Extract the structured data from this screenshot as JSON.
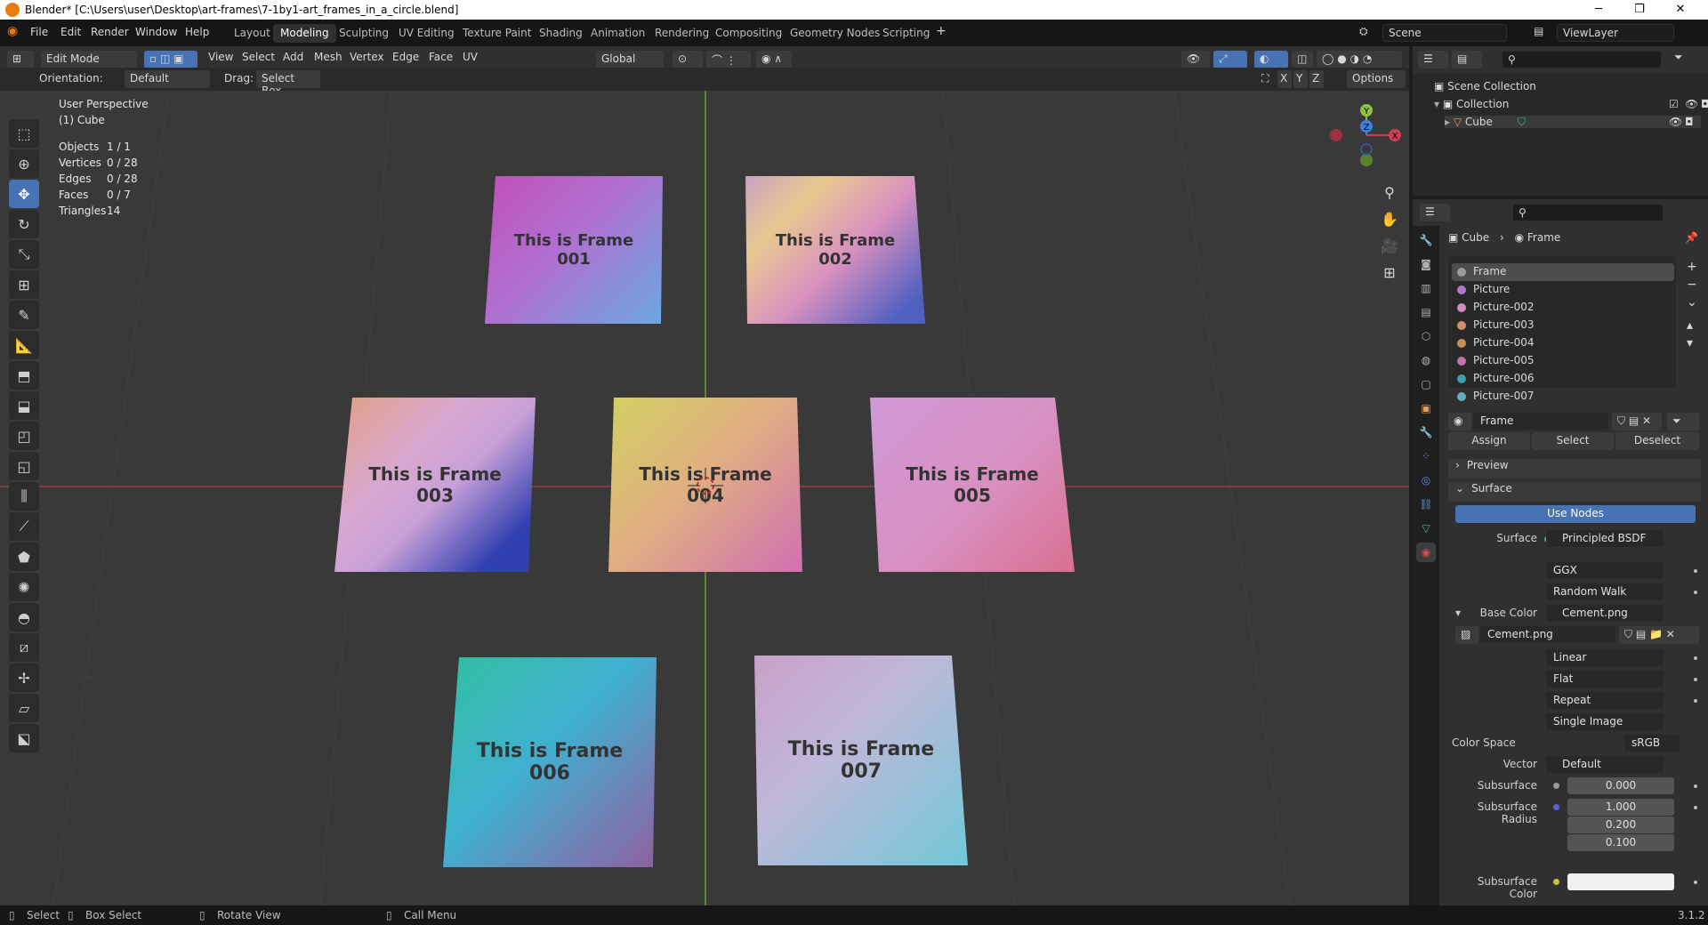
{
  "window": {
    "title": "Blender* [C:\\Users\\user\\Desktop\\art-frames\\7-1by1-art_frames_in_a_circle.blend]"
  },
  "menu": {
    "file": "File",
    "edit": "Edit",
    "render": "Render",
    "window": "Window",
    "help": "Help"
  },
  "workspaces": [
    "Layout",
    "Modeling",
    "Sculpting",
    "UV Editing",
    "Texture Paint",
    "Shading",
    "Animation",
    "Rendering",
    "Compositing",
    "Geometry Nodes",
    "Scripting"
  ],
  "active_workspace": "Modeling",
  "scene": "Scene",
  "view_layer": "ViewLayer",
  "header": {
    "mode": "Edit Mode",
    "view": "View",
    "select": "Select",
    "add": "Add",
    "mesh": "Mesh",
    "vertex": "Vertex",
    "edge": "Edge",
    "face": "Face",
    "uv": "UV",
    "transform": "Global",
    "orientation_label": "Orientation:",
    "orientation": "Default",
    "drag_label": "Drag:",
    "drag": "Select Box",
    "axis_x": "X",
    "axis_y": "Y",
    "axis_z": "Z",
    "options": "Options"
  },
  "viewport": {
    "perspective": "User Perspective",
    "object": "(1) Cube",
    "stats": [
      {
        "label": "Objects",
        "value": "1 / 1"
      },
      {
        "label": "Vertices",
        "value": "0 / 28"
      },
      {
        "label": "Edges",
        "value": "0 / 28"
      },
      {
        "label": "Faces",
        "value": "0 / 7"
      },
      {
        "label": "Triangles",
        "value": "14"
      }
    ],
    "frames": [
      {
        "line1": "This is Frame",
        "line2": "001"
      },
      {
        "line1": "This is Frame",
        "line2": "002"
      },
      {
        "line1": "This is Frame",
        "line2": "003"
      },
      {
        "line1": "This is Frame",
        "line2": "004"
      },
      {
        "line1": "This is Frame",
        "line2": "005"
      },
      {
        "line1": "This is Frame",
        "line2": "006"
      },
      {
        "line1": "This is Frame",
        "line2": "007"
      }
    ],
    "gizmo": {
      "x": "X",
      "y": "Y",
      "z": "Z"
    }
  },
  "outliner": {
    "scene_collection": "Scene Collection",
    "collection": "Collection",
    "object": "Cube"
  },
  "properties": {
    "breadcrumb_object": "Cube",
    "breadcrumb_material": "Frame",
    "materials": [
      {
        "name": "Frame",
        "color": "#9a9a9a"
      },
      {
        "name": "Picture",
        "color": "#b07ad0"
      },
      {
        "name": "Picture-002",
        "color": "#d08ac0"
      },
      {
        "name": "Picture-003",
        "color": "#d09070"
      },
      {
        "name": "Picture-004",
        "color": "#c89050"
      },
      {
        "name": "Picture-005",
        "color": "#c070b0"
      },
      {
        "name": "Picture-006",
        "color": "#40a0b0"
      },
      {
        "name": "Picture-007",
        "color": "#60b0c0"
      }
    ],
    "material_name": "Frame",
    "assign": "Assign",
    "select": "Select",
    "deselect": "Deselect",
    "preview": "Preview",
    "surface_panel": "Surface",
    "use_nodes": "Use Nodes",
    "surface_label": "Surface",
    "surface_value": "Principled BSDF",
    "distribution": "GGX",
    "subsurface_method": "Random Walk",
    "base_color_label": "Base Color",
    "base_color_value": "Cement.png",
    "image_name": "Cement.png",
    "interpolation": "Linear",
    "projection": "Flat",
    "extension": "Repeat",
    "source": "Single Image",
    "color_space_label": "Color Space",
    "color_space": "sRGB",
    "vector_label": "Vector",
    "vector_value": "Default",
    "subsurface_label": "Subsurface",
    "subsurface_value": "0.000",
    "subsurface_radius_label": "Subsurface Radius",
    "subsurface_radius": [
      "1.000",
      "0.200",
      "0.100"
    ],
    "subsurface_color_label": "Subsurface Color"
  },
  "statusbar": {
    "select": "Select",
    "box_select": "Box Select",
    "rotate_view": "Rotate View",
    "call_menu": "Call Menu",
    "version": "3.1.2"
  },
  "colors": {
    "accent": "#4772b3",
    "x_axis": "#d04050",
    "y_axis": "#8cc040",
    "z_axis": "#4080e0"
  }
}
